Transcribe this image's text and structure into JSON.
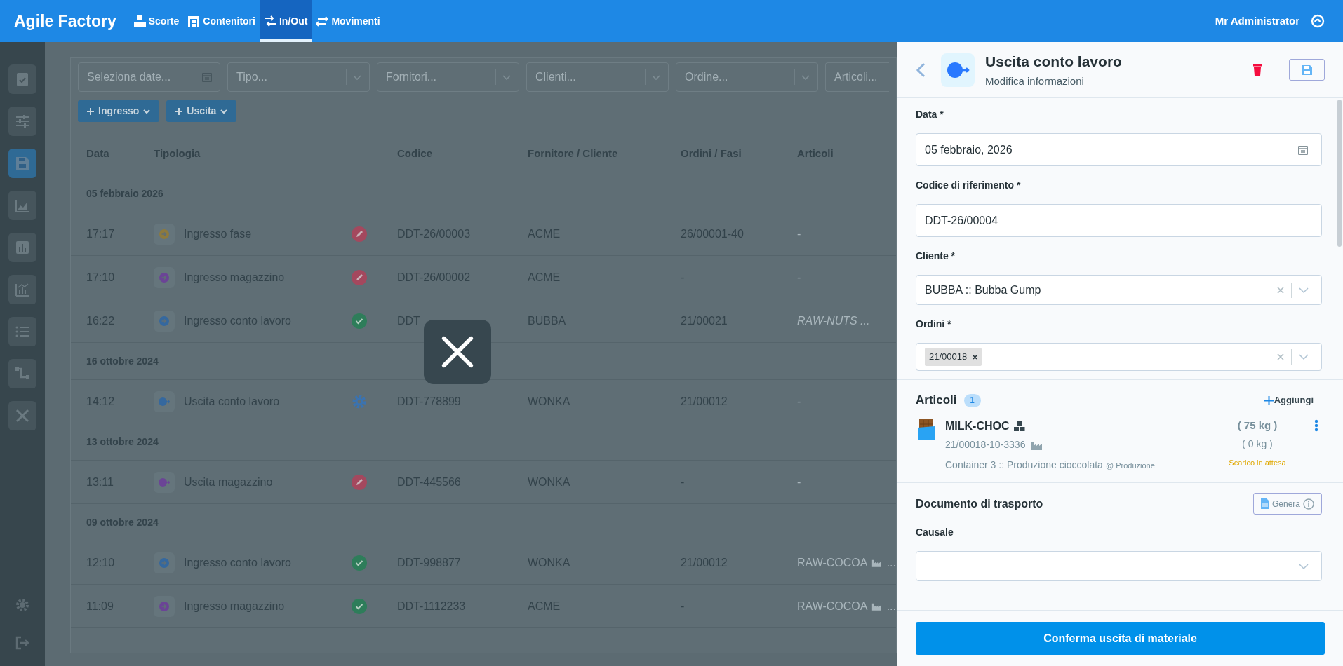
{
  "app": {
    "title": "Agile Factory",
    "user": "Mr Administrator"
  },
  "nav": [
    {
      "label": "Scorte",
      "kind": "boxes",
      "selected": false
    },
    {
      "label": "Contenitori",
      "kind": "shelves",
      "selected": false
    },
    {
      "label": "In/Out",
      "kind": "swap",
      "selected": true
    },
    {
      "label": "Movimenti",
      "kind": "leftright",
      "selected": false
    }
  ],
  "sidebar": {
    "items": [
      {
        "kind": "clipboard",
        "selected": false
      },
      {
        "kind": "sliders",
        "selected": false
      },
      {
        "kind": "save",
        "selected": true
      },
      {
        "kind": "area",
        "selected": false
      },
      {
        "kind": "bars",
        "selected": false
      },
      {
        "kind": "linechart",
        "selected": false
      },
      {
        "kind": "list",
        "selected": false
      },
      {
        "kind": "flow",
        "selected": false
      },
      {
        "kind": "tools",
        "selected": false
      }
    ],
    "bottom": [
      {
        "kind": "gear"
      },
      {
        "kind": "logout"
      }
    ]
  },
  "filters": [
    {
      "kind": "date",
      "placeholder": "Seleziona date..."
    },
    {
      "kind": "select",
      "placeholder": "Tipo..."
    },
    {
      "kind": "select",
      "placeholder": "Fornitori..."
    },
    {
      "kind": "select",
      "placeholder": "Clienti..."
    },
    {
      "kind": "select",
      "placeholder": "Ordine..."
    },
    {
      "kind": "select",
      "placeholder": "Articoli..."
    }
  ],
  "add_buttons": [
    "Ingresso",
    "Uscita"
  ],
  "table": {
    "columns": [
      "Data",
      "Tipologia",
      "Codice",
      "Fornitore / Cliente",
      "Ordini / Fasi",
      "Articoli"
    ],
    "groups": [
      {
        "date": "05 febbraio 2026",
        "rows": [
          {
            "time": "17:17",
            "type": "Ingresso fase",
            "kind": "in",
            "color": "#8d7a3e",
            "status": {
              "kind": "edit"
            },
            "code": "DDT-26/00003",
            "partner": "ACME",
            "orders": "26/00001-40",
            "articles": {
              "kind": "plain",
              "text": "-"
            }
          },
          {
            "time": "17:10",
            "type": "Ingresso magazzino",
            "kind": "in",
            "color": "#6b4496",
            "status": {
              "kind": "edit"
            },
            "code": "DDT-26/00002",
            "partner": "ACME",
            "orders": "-",
            "articles": {
              "kind": "plain",
              "text": "-"
            }
          },
          {
            "time": "16:22",
            "type": "Ingresso conto lavoro",
            "kind": "in",
            "color": "#35689e",
            "status": {
              "kind": "ok"
            },
            "code": "DDT",
            "partner": "BUBBA",
            "orders": "21/00021",
            "articles": {
              "kind": "italic",
              "text": "RAW-NUTS ..."
            }
          }
        ]
      },
      {
        "date": "16 ottobre 2024",
        "rows": [
          {
            "time": "14:12",
            "type": "Uscita conto lavoro",
            "kind": "out",
            "color": "#35689e",
            "status": {
              "kind": "gear"
            },
            "code": "DDT-778899",
            "partner": "WONKA",
            "orders": "21/00012",
            "articles": {
              "kind": "plain",
              "text": "-"
            }
          }
        ]
      },
      {
        "date": "13 ottobre 2024",
        "rows": [
          {
            "time": "13:11",
            "type": "Uscita magazzino",
            "kind": "out",
            "color": "#6b4496",
            "status": {
              "kind": "edit"
            },
            "code": "DDT-445566",
            "partner": "WONKA",
            "orders": "-",
            "articles": {
              "kind": "plain",
              "text": "-"
            }
          }
        ]
      },
      {
        "date": "09 ottobre 2024",
        "rows": [
          {
            "time": "12:10",
            "type": "Ingresso conto lavoro",
            "kind": "in",
            "color": "#35689e",
            "status": {
              "kind": "ok"
            },
            "code": "DDT-998877",
            "partner": "WONKA",
            "orders": "21/00012",
            "articles": {
              "kind": "factory",
              "text": "RAW-COCOA",
              "more": "..."
            }
          },
          {
            "time": "11:09",
            "type": "Ingresso magazzino",
            "kind": "in",
            "color": "#6b4496",
            "status": {
              "kind": "ok"
            },
            "code": "DDT-1112233",
            "partner": "ACME",
            "orders": "-",
            "articles": {
              "kind": "factory",
              "text": "RAW-COCOA",
              "more": "..."
            }
          }
        ]
      }
    ]
  },
  "panel": {
    "title": "Uscita conto lavoro",
    "subtitle": "Modifica informazioni",
    "fields": [
      {
        "kind": "date",
        "label": "Data *",
        "value": "05 febbraio, 2026"
      },
      {
        "kind": "text",
        "label": "Codice di riferimento *",
        "value": "DDT-26/00004"
      },
      {
        "kind": "select",
        "label": "Cliente *",
        "value": "BUBBA :: Bubba Gump"
      },
      {
        "kind": "multi",
        "label": "Ordini *",
        "tags": [
          "21/00018"
        ]
      }
    ],
    "articles": {
      "title": "Articoli",
      "count": "1",
      "add_label": "Aggiungi",
      "items": [
        {
          "name": "MILK-CHOC",
          "code": "21/00018-10-3336",
          "location": "Container 3 :: Produzione cioccolata",
          "area": "@ Produzione",
          "quantity": "( 75 kg )",
          "quantity_done": "( 0 kg )",
          "status": "Scarico in attesa"
        }
      ]
    },
    "transport": {
      "title": "Documento di trasporto",
      "generate_label": "Genera",
      "fields": [
        {
          "kind": "select",
          "label": "Causale"
        }
      ]
    },
    "confirm_label": "Conferma uscita di materiale"
  }
}
